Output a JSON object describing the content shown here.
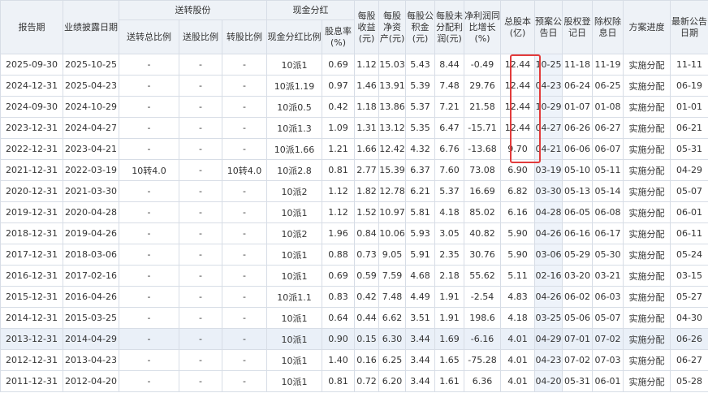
{
  "header": {
    "report_period": "报告期",
    "disclosure_date": "业绩披露日期",
    "bonus_group": "送转股份",
    "total_bonus_ratio": "送转总比例",
    "bonus_ratio": "送股比例",
    "transfer_ratio": "转股比例",
    "cash_group": "现金分红",
    "cash_ratio": "现金分红比例",
    "dividend_yield": "股息率(%)",
    "eps": "每股收益(元)",
    "bvps": "每股净资产(元)",
    "capital_reserve": "每股公积金(元)",
    "undistributed_profit": "每股未分配利润(元)",
    "net_profit_growth": "净利润同比增长(%)",
    "total_shares": "总股本(亿)",
    "announce_date": "预案公告日",
    "record_date": "股权登记日",
    "ex_date": "除权除息日",
    "progress": "方案进度",
    "latest_date": "最新公告日期"
  },
  "rows": [
    {
      "period": "2025-09-30",
      "disclosure": "2025-10-25",
      "total": "-",
      "bonus": "-",
      "transfer": "-",
      "cash": "10派1",
      "yield": "0.69",
      "eps": "1.12",
      "bvps": "15.03",
      "reserve": "5.43",
      "undist": "8.44",
      "growth": "-0.49",
      "shares": "12.44",
      "announce": "10-25",
      "record": "11-18",
      "ex": "11-19",
      "progress": "实施分配",
      "latest": "11-11"
    },
    {
      "period": "2024-12-31",
      "disclosure": "2025-04-23",
      "total": "-",
      "bonus": "-",
      "transfer": "-",
      "cash": "10派1.19",
      "yield": "0.97",
      "eps": "1.46",
      "bvps": "13.91",
      "reserve": "5.39",
      "undist": "7.48",
      "growth": "29.76",
      "shares": "12.44",
      "announce": "04-23",
      "record": "06-24",
      "ex": "06-25",
      "progress": "实施分配",
      "latest": "06-19"
    },
    {
      "period": "2024-09-30",
      "disclosure": "2024-10-29",
      "total": "-",
      "bonus": "-",
      "transfer": "-",
      "cash": "10派0.5",
      "yield": "0.42",
      "eps": "1.18",
      "bvps": "13.86",
      "reserve": "5.37",
      "undist": "7.21",
      "growth": "21.58",
      "shares": "12.44",
      "announce": "10-29",
      "record": "01-07",
      "ex": "01-08",
      "progress": "实施分配",
      "latest": "01-01"
    },
    {
      "period": "2023-12-31",
      "disclosure": "2024-04-27",
      "total": "-",
      "bonus": "-",
      "transfer": "-",
      "cash": "10派1.3",
      "yield": "1.09",
      "eps": "1.31",
      "bvps": "13.12",
      "reserve": "5.35",
      "undist": "6.47",
      "growth": "-15.71",
      "shares": "12.44",
      "announce": "04-27",
      "record": "06-26",
      "ex": "06-27",
      "progress": "实施分配",
      "latest": "06-21"
    },
    {
      "period": "2022-12-31",
      "disclosure": "2023-04-21",
      "total": "-",
      "bonus": "-",
      "transfer": "-",
      "cash": "10派1.66",
      "yield": "1.21",
      "eps": "1.66",
      "bvps": "12.42",
      "reserve": "4.32",
      "undist": "6.76",
      "growth": "-13.68",
      "shares": "9.70",
      "announce": "04-21",
      "record": "06-06",
      "ex": "06-07",
      "progress": "实施分配",
      "latest": "05-31"
    },
    {
      "period": "2021-12-31",
      "disclosure": "2022-03-19",
      "total": "10转4.0",
      "bonus": "-",
      "transfer": "10转4.0",
      "cash": "10派2.8",
      "yield": "0.81",
      "eps": "2.77",
      "bvps": "15.39",
      "reserve": "6.37",
      "undist": "7.60",
      "growth": "73.08",
      "shares": "6.90",
      "announce": "03-19",
      "record": "05-10",
      "ex": "05-11",
      "progress": "实施分配",
      "latest": "04-29"
    },
    {
      "period": "2020-12-31",
      "disclosure": "2021-03-30",
      "total": "-",
      "bonus": "-",
      "transfer": "-",
      "cash": "10派2",
      "yield": "1.12",
      "eps": "1.82",
      "bvps": "12.78",
      "reserve": "6.21",
      "undist": "5.37",
      "growth": "16.69",
      "shares": "6.82",
      "announce": "03-30",
      "record": "05-13",
      "ex": "05-14",
      "progress": "实施分配",
      "latest": "05-07"
    },
    {
      "period": "2019-12-31",
      "disclosure": "2020-04-28",
      "total": "-",
      "bonus": "-",
      "transfer": "-",
      "cash": "10派1",
      "yield": "1.12",
      "eps": "1.52",
      "bvps": "10.97",
      "reserve": "5.81",
      "undist": "4.18",
      "growth": "85.02",
      "shares": "6.16",
      "announce": "04-28",
      "record": "06-05",
      "ex": "06-08",
      "progress": "实施分配",
      "latest": "06-01"
    },
    {
      "period": "2018-12-31",
      "disclosure": "2019-04-26",
      "total": "-",
      "bonus": "-",
      "transfer": "-",
      "cash": "10派2",
      "yield": "1.96",
      "eps": "0.84",
      "bvps": "10.06",
      "reserve": "5.93",
      "undist": "3.05",
      "growth": "40.82",
      "shares": "5.90",
      "announce": "04-26",
      "record": "06-16",
      "ex": "06-17",
      "progress": "实施分配",
      "latest": "06-11"
    },
    {
      "period": "2017-12-31",
      "disclosure": "2018-03-06",
      "total": "-",
      "bonus": "-",
      "transfer": "-",
      "cash": "10派1",
      "yield": "0.88",
      "eps": "0.73",
      "bvps": "9.05",
      "reserve": "5.91",
      "undist": "2.35",
      "growth": "30.76",
      "shares": "5.90",
      "announce": "03-06",
      "record": "05-29",
      "ex": "05-30",
      "progress": "实施分配",
      "latest": "05-24"
    },
    {
      "period": "2016-12-31",
      "disclosure": "2017-02-16",
      "total": "-",
      "bonus": "-",
      "transfer": "-",
      "cash": "10派1",
      "yield": "0.69",
      "eps": "0.59",
      "bvps": "7.59",
      "reserve": "4.68",
      "undist": "2.18",
      "growth": "55.62",
      "shares": "5.11",
      "announce": "02-16",
      "record": "03-20",
      "ex": "03-21",
      "progress": "实施分配",
      "latest": "03-15"
    },
    {
      "period": "2015-12-31",
      "disclosure": "2016-04-26",
      "total": "-",
      "bonus": "-",
      "transfer": "-",
      "cash": "10派1.1",
      "yield": "0.83",
      "eps": "0.42",
      "bvps": "7.48",
      "reserve": "4.49",
      "undist": "1.91",
      "growth": "-2.54",
      "shares": "4.83",
      "announce": "04-26",
      "record": "06-02",
      "ex": "06-03",
      "progress": "实施分配",
      "latest": "05-27"
    },
    {
      "period": "2014-12-31",
      "disclosure": "2015-03-25",
      "total": "-",
      "bonus": "-",
      "transfer": "-",
      "cash": "10派1",
      "yield": "0.64",
      "eps": "0.44",
      "bvps": "6.62",
      "reserve": "3.51",
      "undist": "1.91",
      "growth": "198.6",
      "shares": "4.18",
      "announce": "03-25",
      "record": "05-06",
      "ex": "05-07",
      "progress": "实施分配",
      "latest": "04-30"
    },
    {
      "period": "2013-12-31",
      "disclosure": "2014-04-29",
      "total": "-",
      "bonus": "-",
      "transfer": "-",
      "cash": "10派1",
      "yield": "0.90",
      "eps": "0.15",
      "bvps": "6.30",
      "reserve": "3.44",
      "undist": "1.69",
      "growth": "-6.16",
      "shares": "4.01",
      "announce": "04-29",
      "record": "07-01",
      "ex": "07-02",
      "progress": "实施分配",
      "latest": "06-26"
    },
    {
      "period": "2012-12-31",
      "disclosure": "2013-04-23",
      "total": "-",
      "bonus": "-",
      "transfer": "-",
      "cash": "10派1",
      "yield": "1.40",
      "eps": "0.16",
      "bvps": "6.25",
      "reserve": "3.44",
      "undist": "1.65",
      "growth": "-75.28",
      "shares": "4.01",
      "announce": "04-23",
      "record": "07-02",
      "ex": "07-03",
      "progress": "实施分配",
      "latest": "06-27"
    },
    {
      "period": "2011-12-31",
      "disclosure": "2012-04-20",
      "total": "-",
      "bonus": "-",
      "transfer": "-",
      "cash": "10派1",
      "yield": "0.81",
      "eps": "0.72",
      "bvps": "6.20",
      "reserve": "3.44",
      "undist": "1.61",
      "growth": "6.36",
      "shares": "4.01",
      "announce": "04-20",
      "record": "05-31",
      "ex": "06-01",
      "progress": "实施分配",
      "latest": "05-28"
    }
  ],
  "shaded_rows": [
    13
  ]
}
